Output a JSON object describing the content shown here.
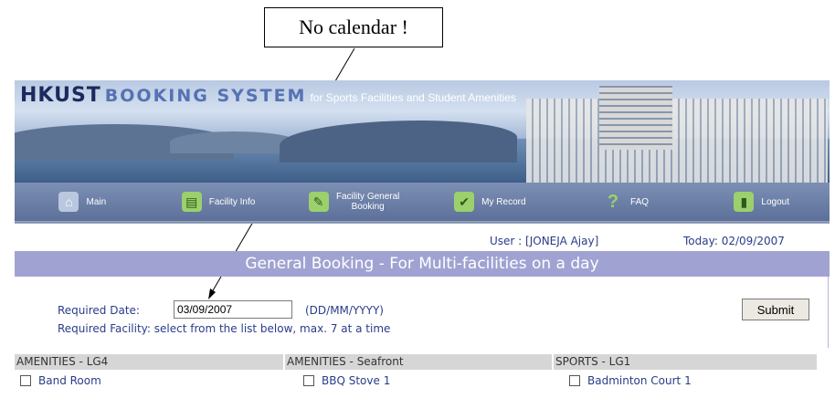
{
  "annotation": {
    "callout_text": "No calendar !"
  },
  "banner": {
    "brand": "HKUST",
    "system": "BOOKING SYSTEM",
    "tagline": "for Sports Facilities and Student Amenities"
  },
  "nav": [
    {
      "label": "Main",
      "icon": "house-icon"
    },
    {
      "label": "Facility Info",
      "icon": "document-icon"
    },
    {
      "label": "Facility General Booking",
      "icon": "booking-icon"
    },
    {
      "label": "My Record",
      "icon": "record-icon"
    },
    {
      "label": "FAQ",
      "icon": "question-icon"
    },
    {
      "label": "Logout",
      "icon": "door-icon"
    }
  ],
  "user": {
    "label": "User : [JONEJA Ajay]",
    "today": "Today: 02/09/2007"
  },
  "page_title": "General Booking - For Multi-facilities on a day",
  "form": {
    "date_label": "Required Date:",
    "date_value": "03/09/2007",
    "date_format": "(DD/MM/YYYY)",
    "facility_label": "Required Facility: select from the list below, max. 7 at a time",
    "submit_label": "Submit"
  },
  "columns": [
    {
      "header": "AMENITIES - LG4",
      "first_item": "Band Room"
    },
    {
      "header": "AMENITIES - Seafront",
      "first_item": "BBQ Stove 1"
    },
    {
      "header": "SPORTS - LG1",
      "first_item": "Badminton Court 1"
    }
  ],
  "colors": {
    "heading_bg": "#a0a3d2",
    "link_text": "#2a3c8a",
    "nav_bg": "#5c709a"
  }
}
